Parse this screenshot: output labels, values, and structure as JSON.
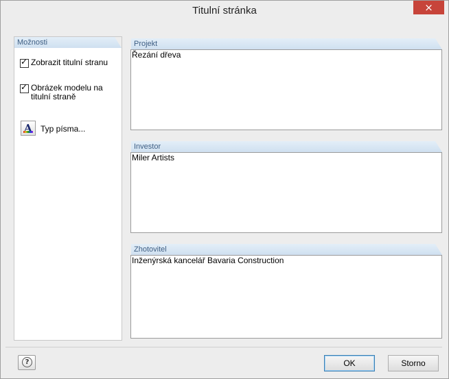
{
  "window": {
    "title": "Titulní stránka",
    "close_glyph": "×"
  },
  "options": {
    "header": "Možnosti",
    "show_title_page": {
      "label": "Zobrazit titulní stranu",
      "checked": true
    },
    "model_image": {
      "label_line1": "Obrázek modelu na",
      "label_line2": "titulní straně",
      "checked": true
    },
    "font_button_label": "Typ písma..."
  },
  "fields": {
    "project": {
      "header": "Projekt",
      "value": "Řezání dřeva"
    },
    "investor": {
      "header": "Investor",
      "value": "Miler Artists"
    },
    "contractor": {
      "header": "Zhotovitel",
      "value": "Inženýrská kancelář Bavaria Construction"
    }
  },
  "footer": {
    "help_glyph": "?",
    "ok_label": "OK",
    "cancel_label": "Storno"
  },
  "colors": {
    "section_header_text": "#3e5e83",
    "close_button": "#c7443a"
  }
}
